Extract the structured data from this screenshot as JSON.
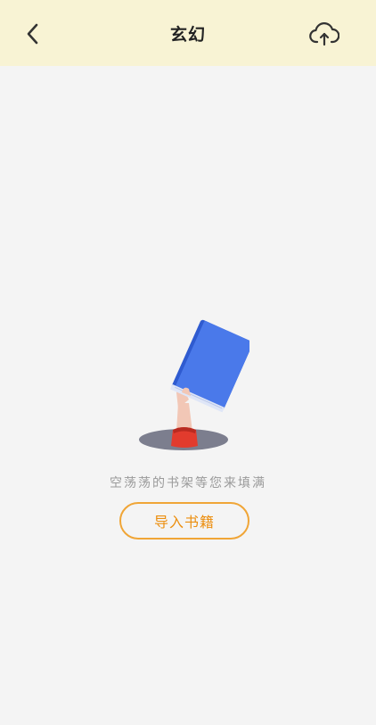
{
  "header": {
    "title": "玄幻",
    "back_icon": "chevron-left-icon",
    "upload_icon": "cloud-upload-icon",
    "background_color": "#f8f3d4"
  },
  "empty_state": {
    "illustration": "hand-holding-book-illustration",
    "message": "空荡荡的书架等您来填满",
    "import_button_label": "导入书籍",
    "accent_color": "#f0a536"
  }
}
